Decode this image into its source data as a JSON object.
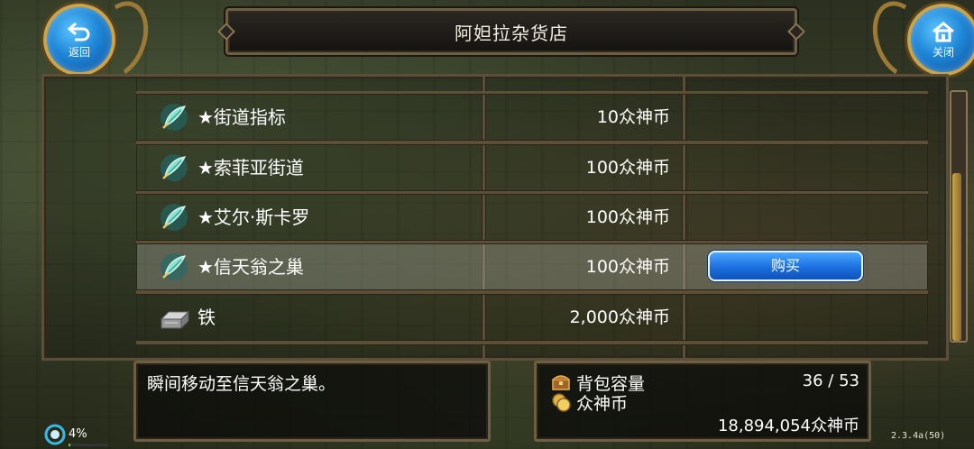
{
  "header": {
    "title": "阿妲拉杂货店",
    "back_label": "返回",
    "close_label": "关闭"
  },
  "items": [
    {
      "name": "★街道指标",
      "price": "10众神币",
      "icon": "wing-feather-icon"
    },
    {
      "name": "★索菲亚街道",
      "price": "100众神币",
      "icon": "wing-feather-icon"
    },
    {
      "name": "★艾尔·斯卡罗",
      "price": "100众神币",
      "icon": "wing-feather-icon"
    },
    {
      "name": "★信天翁之巢",
      "price": "100众神币",
      "icon": "wing-feather-icon",
      "selected": true
    },
    {
      "name": "铁",
      "price": "2,000众神币",
      "icon": "iron-ingot-icon"
    }
  ],
  "buy_label": "购买",
  "description": "瞬间移动至信天翁之巢。",
  "inventory": {
    "capacity_label": "背包容量",
    "capacity_value": "36 / 53",
    "currency_label": "众神币",
    "currency_value": "18,894,054众神币"
  },
  "status": {
    "battery": "4%",
    "battery_fraction": 0.04,
    "version": "2.3.4a(50)"
  },
  "colors": {
    "accent_blue": "#1c6fe0",
    "frame_gold": "#c9a44a",
    "frame_border": "#5c4f38"
  }
}
